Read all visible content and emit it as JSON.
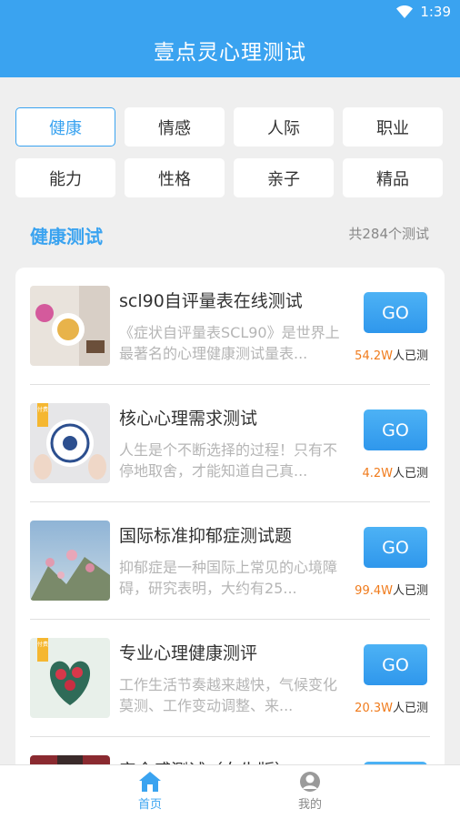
{
  "status": {
    "time": "1:39"
  },
  "header": {
    "title": "壹点灵心理测试"
  },
  "categories": [
    "健康",
    "情感",
    "人际",
    "职业",
    "能力",
    "性格",
    "亲子",
    "精品"
  ],
  "section": {
    "title": "健康测试",
    "count": "共284个测试"
  },
  "tests": [
    {
      "title": "scl90自评量表在线测试",
      "desc": "《症状自评量表SCL90》是世界上最著名的心理健康测试量表...",
      "count_num": "54.2W",
      "count_suffix": "人已测",
      "go": "GO",
      "paid": false
    },
    {
      "title": "核心心理需求测试",
      "desc": "人生是个不断选择的过程！只有不停地取舍，才能知道自己真...",
      "count_num": "4.2W",
      "count_suffix": "人已测",
      "go": "GO",
      "paid": true,
      "paid_label": "付费"
    },
    {
      "title": "国际标准抑郁症测试题",
      "desc": "抑郁症是一种国际上常见的心境障碍，研究表明，大约有25...",
      "count_num": "99.4W",
      "count_suffix": "人已测",
      "go": "GO",
      "paid": false
    },
    {
      "title": "专业心理健康测评",
      "desc": "工作生活节奏越来越快，气候变化莫测、工作变动调整、来...",
      "count_num": "20.3W",
      "count_suffix": "人已测",
      "go": "GO",
      "paid": true,
      "paid_label": "付费"
    },
    {
      "title": "安全感测试（女生版）",
      "desc": "",
      "count_num": "",
      "count_suffix": "",
      "go": "GO",
      "paid": false
    }
  ],
  "tabbar": {
    "home": "首页",
    "me": "我的"
  }
}
